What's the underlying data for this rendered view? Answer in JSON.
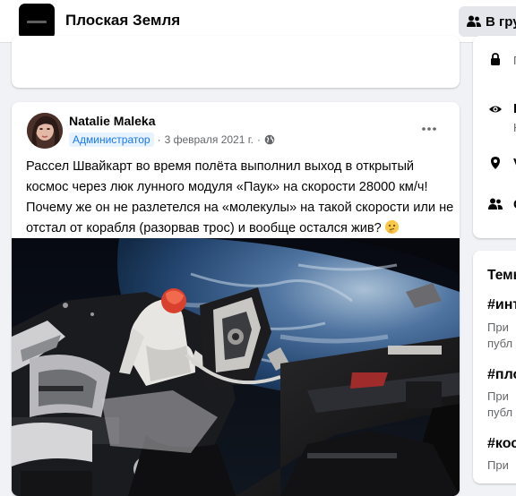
{
  "header": {
    "group_name": "Плоская Земля",
    "group_button_label": "В гру",
    "group_button_icon": "people-icon"
  },
  "post": {
    "author": "Natalie Maleka",
    "role": "Администратор",
    "separator": "·",
    "date": "3 февраля 2021 г.",
    "dot": "·",
    "privacy_icon": "globe-icon",
    "more_icon": "more-dots-icon",
    "text": "Рассел Швайкарт во время полёта выполнил  выход в открытый космос через люк лунного модуля «Паук» на скорости 28000 км/ч! Почему же он не разлетелся на «молекулы» на такой скорости или не отстал от корабля (разорвав трос) и вообще остался жив?",
    "emoji": "thinking-face-emoji"
  },
  "sidebar": {
    "about_rows": [
      {
        "icon": "lock-icon",
        "label": "",
        "sub": "П"
      },
      {
        "icon": "eye-icon",
        "label": "В",
        "sub": "Н"
      },
      {
        "icon": "location-icon",
        "label": "V",
        "sub": ""
      },
      {
        "icon": "people-icon",
        "label": "С",
        "sub": ""
      }
    ],
    "topics_heading": "Темы",
    "topics": [
      {
        "tag": "#инт",
        "line1": "При",
        "line2": "публ"
      },
      {
        "tag": "#пло",
        "line1": "При",
        "line2": "публ"
      },
      {
        "tag": "#кос",
        "line1": "При",
        "line2": ""
      }
    ]
  },
  "colors": {
    "accent": "#1877f2",
    "background": "#f0f2f5",
    "role_badge_bg": "#e7f3ff"
  }
}
